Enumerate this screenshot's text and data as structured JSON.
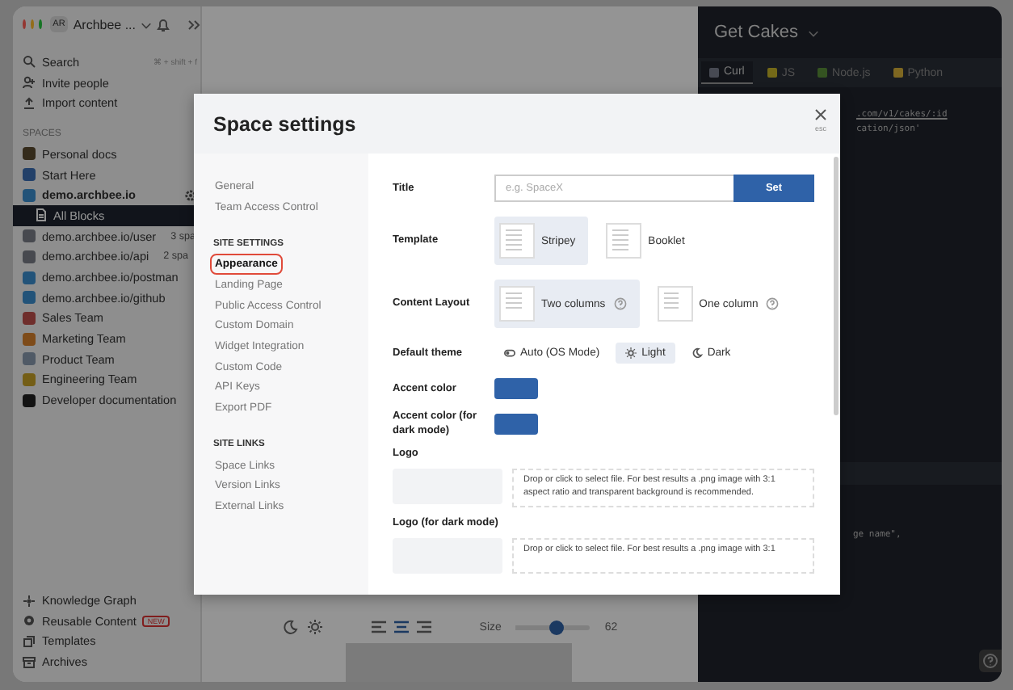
{
  "app": {
    "avatar": "AR",
    "workspace": "Archbee ..."
  },
  "sidebar": {
    "actions": [
      {
        "label": "Search",
        "shortcut": "⌘ + shift + f"
      },
      {
        "label": "Invite people"
      },
      {
        "label": "Import content"
      }
    ],
    "spaces_heading": "SPACES",
    "spaces": [
      {
        "label": "Personal docs",
        "selected": false
      },
      {
        "label": "Start Here",
        "selected": false
      },
      {
        "label": "demo.archbee.io",
        "selected": false,
        "expanded": true,
        "children": [
          {
            "label": "All Blocks",
            "selected": true
          }
        ]
      },
      {
        "label": "demo.archbee.io/user",
        "note": "3 spa",
        "selected": false
      },
      {
        "label": "demo.archbee.io/api",
        "note": "2 spa",
        "selected": false
      },
      {
        "label": "demo.archbee.io/postman",
        "selected": false
      },
      {
        "label": "demo.archbee.io/github",
        "selected": false
      },
      {
        "label": "Sales Team",
        "selected": false
      },
      {
        "label": "Marketing Team",
        "selected": false
      },
      {
        "label": "Product Team",
        "selected": false
      },
      {
        "label": "Engineering Team",
        "selected": false
      },
      {
        "label": "Developer documentation",
        "selected": false
      }
    ],
    "footer": [
      {
        "label": "Knowledge Graph"
      },
      {
        "label": "Reusable Content",
        "badge": "NEW"
      },
      {
        "label": "Templates"
      },
      {
        "label": "Archives"
      }
    ]
  },
  "editor": {
    "align": [
      {
        "selected": false
      },
      {
        "selected": true
      },
      {
        "selected": false
      }
    ],
    "size_label": "Size",
    "size": {
      "level": 0.55
    },
    "size_value": "62"
  },
  "code_panel": {
    "title": "Get Cakes",
    "tabs": [
      {
        "label": "Curl",
        "selected": true
      },
      {
        "label": "JS",
        "selected": false
      },
      {
        "label": "Node.js",
        "selected": false
      },
      {
        "label": "Python",
        "selected": false
      }
    ],
    "request_lines": [
      ".com/v1/cakes/:id",
      "cation/json'"
    ],
    "response_lines": [
      "ge name\","
    ]
  },
  "modal": {
    "title": "Space settings",
    "close_hint": "esc",
    "nav": [
      {
        "items": [
          {
            "label": "General",
            "selected": false
          },
          {
            "label": "Team Access Control",
            "selected": false
          }
        ]
      },
      {
        "heading": "SITE SETTINGS",
        "items": [
          {
            "label": "Appearance",
            "selected": true
          },
          {
            "label": "Landing Page",
            "selected": false
          },
          {
            "label": "Public Access Control",
            "selected": false
          },
          {
            "label": "Custom Domain",
            "selected": false
          },
          {
            "label": "Widget Integration",
            "selected": false
          },
          {
            "label": "Custom Code",
            "selected": false
          },
          {
            "label": "API Keys",
            "selected": false
          },
          {
            "label": "Export PDF",
            "selected": false
          }
        ]
      },
      {
        "heading": "SITE LINKS",
        "items": [
          {
            "label": "Space Links",
            "selected": false
          },
          {
            "label": "Version Links",
            "selected": false
          },
          {
            "label": "External Links",
            "selected": false
          }
        ]
      }
    ],
    "title_field": {
      "label": "Title",
      "placeholder": "e.g. SpaceX",
      "button": "Set"
    },
    "template": {
      "label": "Template",
      "options": [
        {
          "label": "Stripey",
          "selected": true
        },
        {
          "label": "Booklet",
          "selected": false
        }
      ]
    },
    "layout": {
      "label": "Content Layout",
      "options": [
        {
          "label": "Two columns",
          "selected": true,
          "help": true
        },
        {
          "label": "One column",
          "selected": false,
          "help": true
        }
      ]
    },
    "theme": {
      "label": "Default theme",
      "options": [
        {
          "label": "Auto (OS Mode)",
          "selected": false
        },
        {
          "label": "Light",
          "selected": true
        },
        {
          "label": "Dark",
          "selected": false
        }
      ]
    },
    "accents": [
      {
        "label": "Accent color",
        "color": "#2f62a8"
      },
      {
        "label": "Accent color (for dark mode)",
        "color": "#2f62a8"
      }
    ],
    "logos": [
      {
        "label": "Logo",
        "hint": "Drop or click to select file. For best results a .png image with 3:1 aspect ratio and transparent background is recommended."
      },
      {
        "label": "Logo (for dark mode)",
        "hint": "Drop or click to select file. For best results a .png image with 3:1"
      }
    ]
  }
}
